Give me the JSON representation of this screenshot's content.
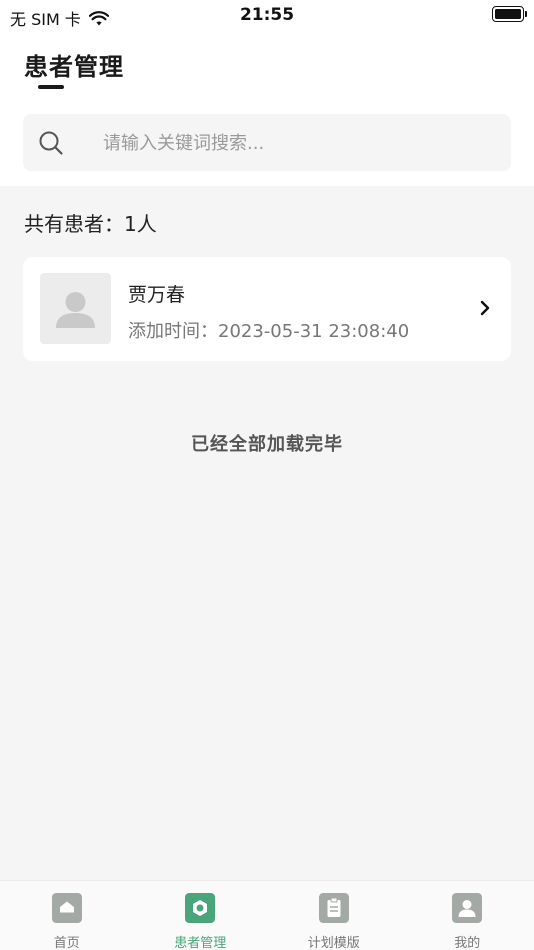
{
  "status_bar": {
    "carrier": "无 SIM 卡",
    "time": "21:55"
  },
  "page": {
    "title": "患者管理"
  },
  "search": {
    "placeholder": "请输入关键词搜索..."
  },
  "summary": {
    "count_text": "共有患者：1人"
  },
  "patients": [
    {
      "name": "贾万春",
      "added_time": "添加时间：2023-05-31 23:08:40"
    }
  ],
  "list_footer": {
    "text": "已经全部加载完毕"
  },
  "tabbar": {
    "tabs": [
      {
        "label": "首页",
        "icon": "home-icon",
        "active": false
      },
      {
        "label": "患者管理",
        "icon": "patient-icon",
        "active": true
      },
      {
        "label": "计划模版",
        "icon": "clipboard-icon",
        "active": false
      },
      {
        "label": "我的",
        "icon": "person-icon",
        "active": false
      }
    ]
  },
  "colors": {
    "accent": "#4aa67a",
    "inactive_icon": "#a3a9a5",
    "background": "#f5f5f5"
  }
}
